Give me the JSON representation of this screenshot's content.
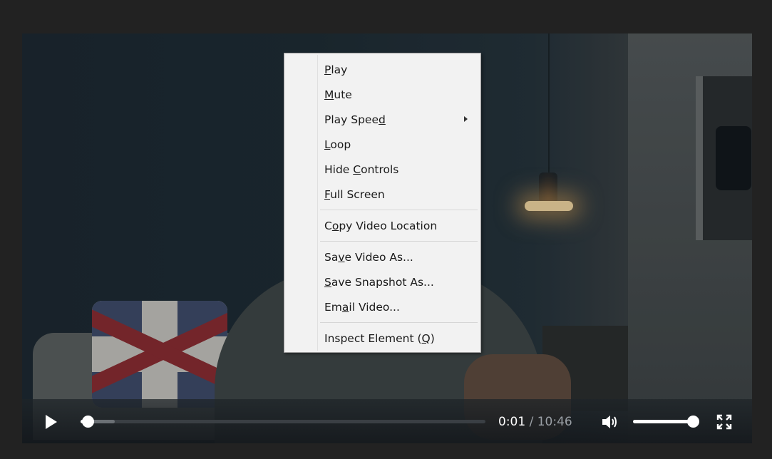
{
  "player": {
    "time_current": "0:01",
    "time_separator": "/",
    "time_total": "10:46",
    "progress_fraction": 0.017,
    "buffered_fraction": 0.085,
    "volume_fraction": 1.0,
    "icons": {
      "play": "play-icon",
      "volume": "speaker-volume-icon",
      "fullscreen": "fullscreen-icon"
    }
  },
  "context_menu": {
    "items": [
      {
        "label_pre": "",
        "label_key": "P",
        "label_post": "lay"
      },
      {
        "label_pre": "",
        "label_key": "M",
        "label_post": "ute"
      },
      {
        "label_pre": "Play Spee",
        "label_key": "d",
        "label_post": ""
      },
      {
        "label_pre": "",
        "label_key": "L",
        "label_post": "oop"
      },
      {
        "label_pre": "Hide ",
        "label_key": "C",
        "label_post": "ontrols"
      },
      {
        "label_pre": "",
        "label_key": "F",
        "label_post": "ull Screen"
      },
      {
        "label_pre": "C",
        "label_key": "o",
        "label_post": "py Video Location"
      },
      {
        "label_pre": "Sa",
        "label_key": "v",
        "label_post": "e Video As..."
      },
      {
        "label_pre": "",
        "label_key": "S",
        "label_post": "ave Snapshot As..."
      },
      {
        "label_pre": "Em",
        "label_key": "a",
        "label_post": "il Video..."
      },
      {
        "label_pre": "Inspect Element (",
        "label_key": "Q",
        "label_post": ")"
      }
    ]
  },
  "colors": {
    "menu_bg": "#f2f2f2",
    "menu_border": "#9c9c9c",
    "progress_played": "#ffffff",
    "time_total": "#9aa0a6"
  }
}
